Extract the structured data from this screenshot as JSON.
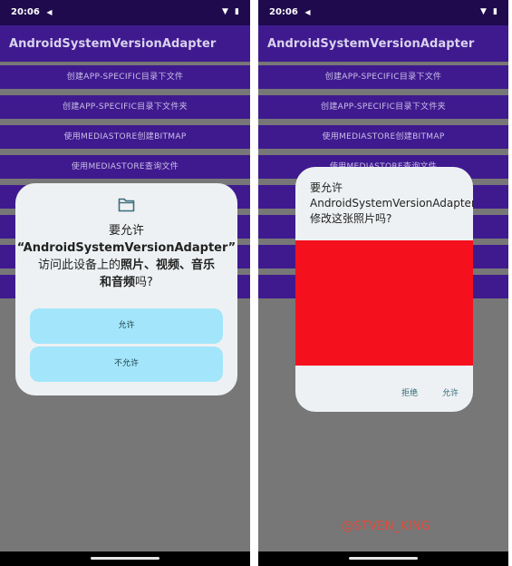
{
  "status_bar": {
    "time": "20:06",
    "nav_glyph": "◀",
    "wifi_glyph": "▼",
    "battery_glyph": "▮"
  },
  "app": {
    "title": "AndroidSystemVersionAdapter",
    "buttons": [
      "创建APP-SPECIFIC目录下文件",
      "创建APP-SPECIFIC目录下文件夹",
      "使用MEDIASTORE创建BITMAP",
      "使用MEDIASTORE查询文件",
      "",
      "",
      "",
      ""
    ]
  },
  "permission_dialog": {
    "icon": "folder-icon",
    "line1": "要允许",
    "line2": "“AndroidSystemVersionAdapter”",
    "line3_pre": "访问此设备上的",
    "line3_bold": "照片、视频、音乐",
    "line4_bold": "和音频",
    "line4_post": "吗?",
    "allow": "允许",
    "deny": "不允许"
  },
  "edit_dialog": {
    "question": "要允许AndroidSystemVersionAdapter修改这张照片吗?",
    "preview_color": "#f5101e",
    "deny": "拒绝",
    "allow": "允许"
  },
  "watermark": "@STVEN_KING",
  "colors": {
    "status_bar": "#1e0a4d",
    "app_bar": "#3f1a8f",
    "dialog": "#eef1f3",
    "button_fill": "#a3e6fb"
  }
}
